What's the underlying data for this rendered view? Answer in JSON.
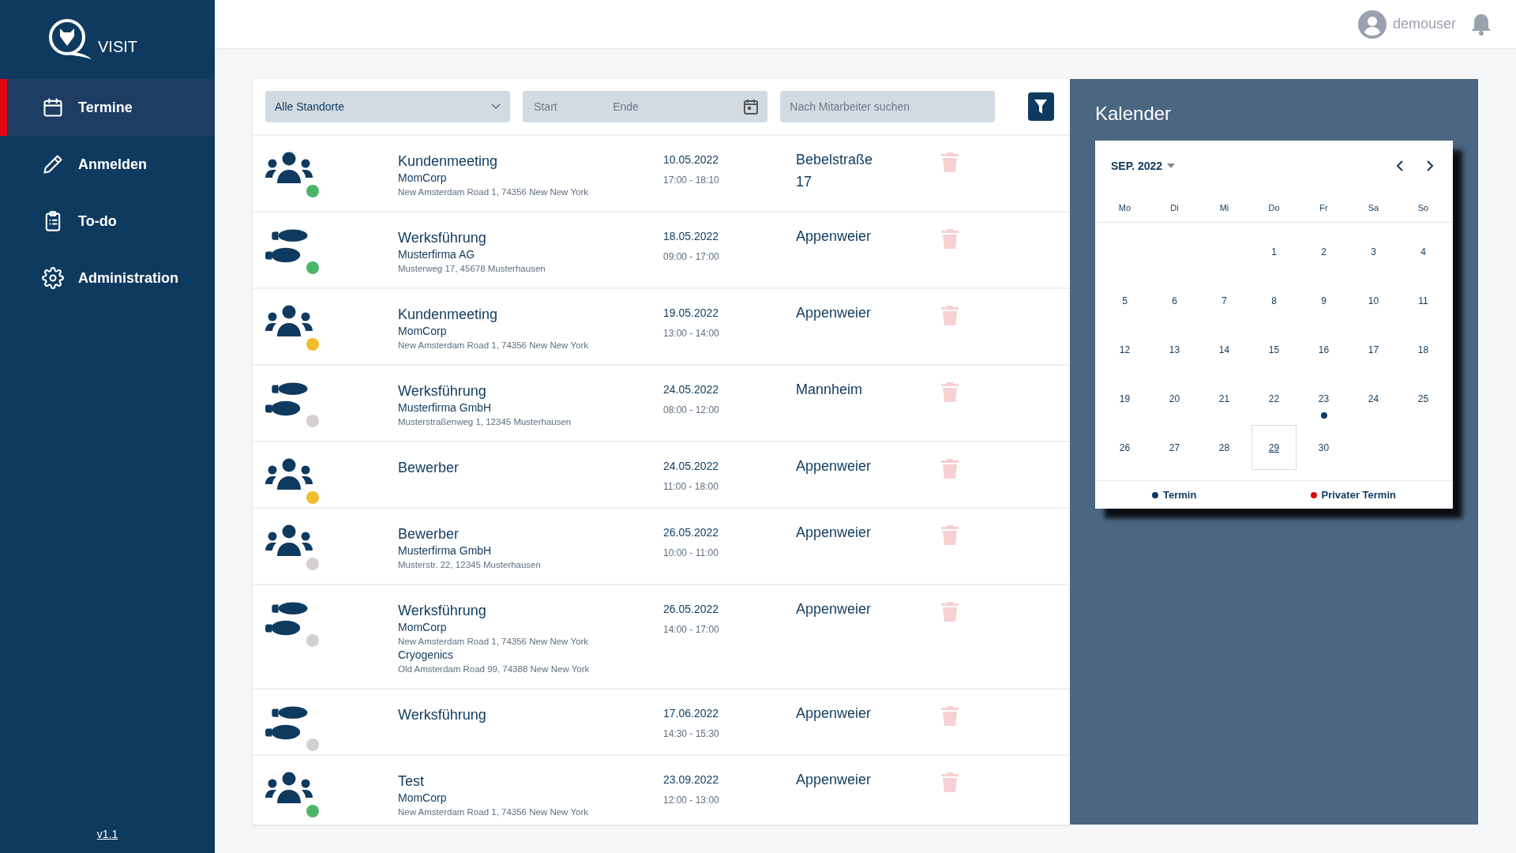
{
  "sidebar": {
    "logo_text": "VISIT",
    "items": [
      {
        "label": "Termine",
        "selected": true
      },
      {
        "label": "Anmelden",
        "selected": false
      },
      {
        "label": "To-do",
        "selected": false
      },
      {
        "label": "Administration",
        "selected": false
      }
    ],
    "version": "v1.1"
  },
  "header": {
    "user": "demouser"
  },
  "filters": {
    "location": "Alle Standorte",
    "start_placeholder": "Start",
    "end_placeholder": "Ende",
    "search_placeholder": "Nach Mitarbeiter suchen"
  },
  "appointments": [
    {
      "kind": "group",
      "color": "#4cb56a",
      "title": "Kundenmeeting",
      "companies": [
        {
          "name": "MomCorp",
          "address": "New Amsterdam Road 1, 74356 New New York"
        }
      ],
      "date": "10.05.2022",
      "time": "17:00 - 18:10",
      "location": "Bebelstraße 17"
    },
    {
      "kind": "tour",
      "color": "#4cb56a",
      "title": "Werksführung",
      "companies": [
        {
          "name": "Musterfirma AG",
          "address": "Musterweg 17, 45678 Musterhausen"
        }
      ],
      "date": "18.05.2022",
      "time": "09:00 - 17:00",
      "location": "Appenweier"
    },
    {
      "kind": "group",
      "color": "#f2bd2c",
      "title": "Kundenmeeting",
      "companies": [
        {
          "name": "MomCorp",
          "address": "New Amsterdam Road 1, 74356 New New York"
        }
      ],
      "date": "19.05.2022",
      "time": "13:00 - 14:00",
      "location": "Appenweier"
    },
    {
      "kind": "tour",
      "color": "#d5d0d0",
      "title": "Werksführung",
      "companies": [
        {
          "name": "Musterfirma GmbH",
          "address": "Musterstraßenweg 1, 12345 Musterhausen"
        }
      ],
      "date": "24.05.2022",
      "time": "08:00 - 12:00",
      "location": "Mannheim"
    },
    {
      "kind": "group",
      "color": "#f2bd2c",
      "title": "Bewerber",
      "date": "24.05.2022",
      "time": "11:00 - 18:00",
      "location": "Appenweier"
    },
    {
      "kind": "group",
      "color": "#d5d0d0",
      "title": "Bewerber",
      "companies": [
        {
          "name": "Musterfirma GmbH",
          "address": "Musterstr. 22, 12345 Musterhausen"
        }
      ],
      "date": "26.05.2022",
      "time": "10:00 - 11:00",
      "location": "Appenweier"
    },
    {
      "kind": "tour",
      "color": "#d5d0d0",
      "title": "Werksführung",
      "companies": [
        {
          "name": "MomCorp",
          "address": "New Amsterdam Road 1, 74356 New New York"
        },
        {
          "name": "Cryogenics",
          "address": "Old Amsterdam Road 99, 74388 New New York"
        }
      ],
      "date": "26.05.2022",
      "time": "14:00 - 17:00",
      "location": "Appenweier"
    },
    {
      "kind": "tour",
      "color": "#d5d0d0",
      "title": "Werksführung",
      "date": "17.06.2022",
      "time": "14:30 - 15:30",
      "location": "Appenweier"
    },
    {
      "kind": "group",
      "color": "#4cb56a",
      "title": "Test",
      "companies": [
        {
          "name": "MomCorp",
          "address": "New Amsterdam Road 1, 74356 New New York"
        }
      ],
      "date": "23.09.2022",
      "time": "12:00 - 13:00",
      "location": "Appenweier"
    }
  ],
  "calendar": {
    "title": "Kalender",
    "month": "SEP. 2022",
    "weekdays": [
      "Mo",
      "Di",
      "Mi",
      "Do",
      "Fr",
      "Sa",
      "So"
    ],
    "weeks": [
      [
        {
          "day": "1",
          "selected": false,
          "event": false
        },
        {
          "day": "2",
          "selected": false,
          "event": false
        },
        {
          "day": "3",
          "selected": false,
          "event": false
        },
        {
          "day": "4",
          "selected": false,
          "event": false
        }
      ],
      [
        {
          "day": "5",
          "selected": false,
          "event": false
        },
        {
          "day": "6",
          "selected": false,
          "event": false
        },
        {
          "day": "7",
          "selected": false,
          "event": false
        },
        {
          "day": "8",
          "selected": false,
          "event": false
        },
        {
          "day": "9",
          "selected": false,
          "event": false
        },
        {
          "day": "10",
          "selected": false,
          "event": false
        },
        {
          "day": "11",
          "selected": false,
          "event": false
        }
      ],
      [
        {
          "day": "12",
          "selected": false,
          "event": false
        },
        {
          "day": "13",
          "selected": false,
          "event": false
        },
        {
          "day": "14",
          "selected": false,
          "event": false
        },
        {
          "day": "15",
          "selected": false,
          "event": false
        },
        {
          "day": "16",
          "selected": false,
          "event": false
        },
        {
          "day": "17",
          "selected": false,
          "event": false
        },
        {
          "day": "18",
          "selected": false,
          "event": false
        }
      ],
      [
        {
          "day": "19",
          "selected": false,
          "event": false
        },
        {
          "day": "20",
          "selected": false,
          "event": false
        },
        {
          "day": "21",
          "selected": false,
          "event": false
        },
        {
          "day": "22",
          "selected": false,
          "event": false
        },
        {
          "day": "23",
          "selected": false,
          "event": true
        },
        {
          "day": "24",
          "selected": false,
          "event": false
        },
        {
          "day": "25",
          "selected": false,
          "event": false
        }
      ],
      [
        {
          "day": "26",
          "selected": false,
          "event": false
        },
        {
          "day": "27",
          "selected": false,
          "event": false
        },
        {
          "day": "28",
          "selected": false,
          "event": false
        },
        {
          "day": "29",
          "selected": true,
          "event": false
        },
        {
          "day": "30",
          "selected": false,
          "event": false
        }
      ]
    ],
    "legend": [
      {
        "label": "Termin",
        "color": "#0f3a5f"
      },
      {
        "label": "Privater Termin",
        "color": "#e30613"
      }
    ]
  }
}
